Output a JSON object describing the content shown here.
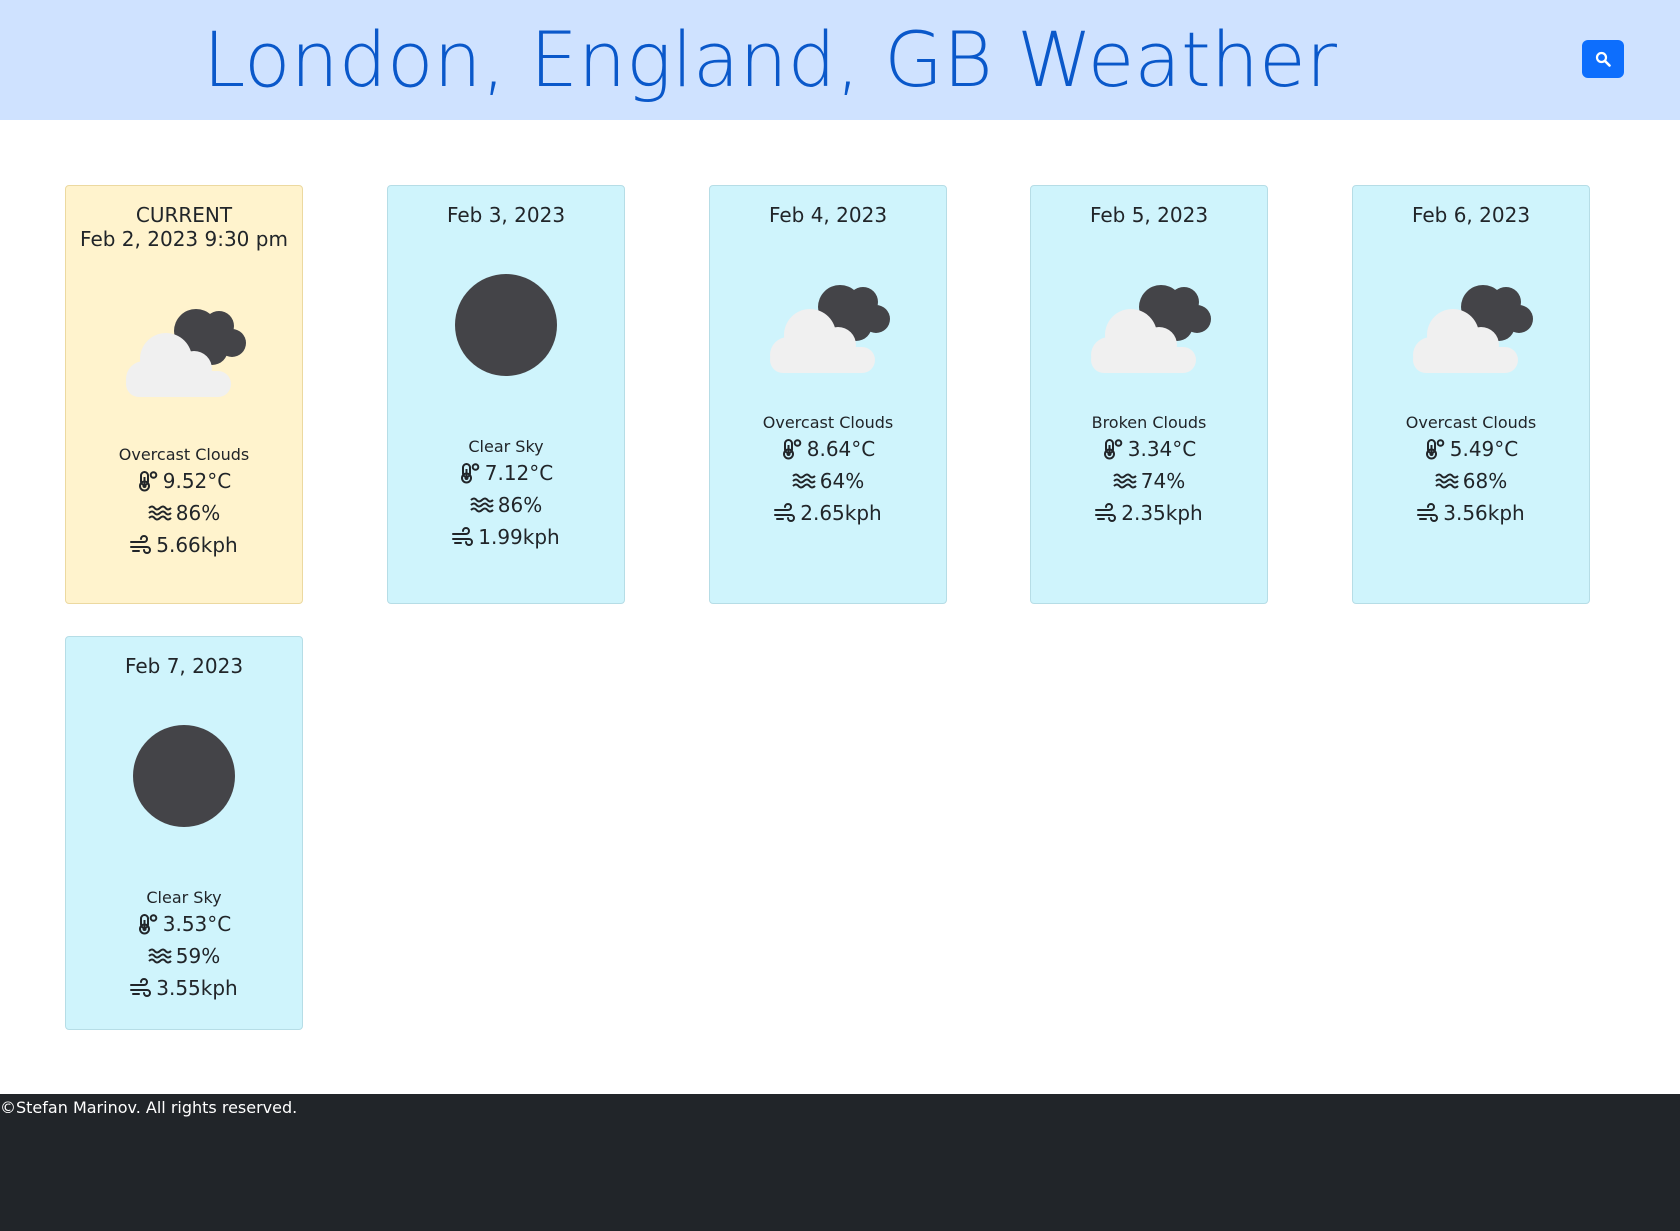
{
  "header": {
    "title": "London, England, GB Weather",
    "search_icon": "search-icon"
  },
  "cards": [
    {
      "label": "CURRENT",
      "date": "Feb 2, 2023 9:30 pm",
      "icon": "overcast-clouds-icon",
      "description": "Overcast Clouds",
      "temperature": "9.52°C",
      "humidity": "86%",
      "wind": "5.66kph"
    },
    {
      "date": "Feb 3, 2023",
      "icon": "clear-sky-icon",
      "description": "Clear Sky",
      "temperature": "7.12°C",
      "humidity": "86%",
      "wind": "1.99kph"
    },
    {
      "date": "Feb 4, 2023",
      "icon": "overcast-clouds-icon",
      "description": "Overcast Clouds",
      "temperature": "8.64°C",
      "humidity": "64%",
      "wind": "2.65kph"
    },
    {
      "date": "Feb 5, 2023",
      "icon": "broken-clouds-icon",
      "description": "Broken Clouds",
      "temperature": "3.34°C",
      "humidity": "74%",
      "wind": "2.35kph"
    },
    {
      "date": "Feb 6, 2023",
      "icon": "overcast-clouds-icon",
      "description": "Overcast Clouds",
      "temperature": "5.49°C",
      "humidity": "68%",
      "wind": "3.56kph"
    },
    {
      "date": "Feb 7, 2023",
      "icon": "clear-sky-icon",
      "description": "Clear Sky",
      "temperature": "3.53°C",
      "humidity": "59%",
      "wind": "3.55kph"
    }
  ],
  "footer": {
    "text": "©Stefan Marinov. All rights reserved."
  },
  "colors": {
    "header_bg": "#cfe2ff",
    "title": "#0a58ca",
    "search_button": "#0d6efd",
    "current_card_bg": "#fff3cd",
    "forecast_card_bg": "#cff4fc",
    "footer_bg": "#212529"
  }
}
